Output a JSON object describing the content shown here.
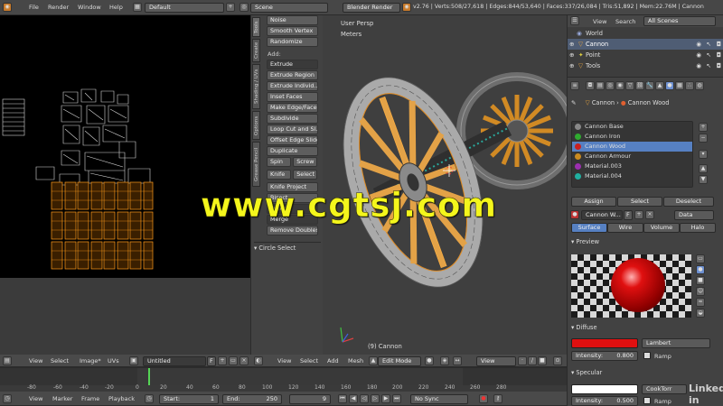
{
  "topbar": {
    "menus": [
      "File",
      "Render",
      "Window",
      "Help"
    ],
    "layout": "Default",
    "scene": "Scene",
    "engine": "Blender Render",
    "stats": "v2.76 | Verts:508/27,618 | Edges:844/53,640 | Faces:337/26,084 | Tris:51,892 | Mem:22.76M | Cannon"
  },
  "toolshelf": {
    "vtabs": [
      "Tools",
      "Create",
      "Shading / UVs",
      "Options",
      "Grease Pencil"
    ],
    "top_buttons": [
      "Noise",
      "Smooth Vertex",
      "Randomize"
    ],
    "add_label": "Add:",
    "extrude": "Extrude",
    "buttons": [
      "Extrude Region",
      "Extrude Individ...",
      "Inset Faces",
      "Make Edge/Face",
      "Subdivide",
      "Loop Cut and Sl...",
      "Offset Edge Slide",
      "Duplicate"
    ],
    "spin": "Spin",
    "screw": "Screw",
    "knife": "Knife",
    "select": "Select",
    "knife_project": "Knife Project",
    "bisect": "Bisect",
    "delete": "Delete",
    "merge": "Merge",
    "remove_doubles": "Remove Doubles",
    "operator_panel": "Circle Select"
  },
  "viewport": {
    "view_name": "User Persp",
    "units": "Meters",
    "object_label": "(9) Cannon"
  },
  "watermark": "www.cgtsj.com",
  "uv_header": {
    "items": [
      "View",
      "Select",
      "Image*",
      "UVs"
    ],
    "image_name": "Untitled",
    "f_label": "F"
  },
  "view3d_header": {
    "items": [
      "View",
      "Select",
      "Add",
      "Mesh"
    ],
    "mode": "Edit Mode",
    "pivot": "View"
  },
  "timeline": {
    "ticks": [
      "-80",
      "-60",
      "-40",
      "-20",
      "0",
      "20",
      "40",
      "60",
      "80",
      "100",
      "120",
      "140",
      "160",
      "180",
      "200",
      "220",
      "240",
      "260",
      "280"
    ],
    "menu": [
      "View",
      "Marker",
      "Frame",
      "Playback"
    ],
    "start_label": "Start:",
    "start": "1",
    "end_label": "End:",
    "end": "250",
    "current": "9",
    "sync": "No Sync"
  },
  "outliner": {
    "view": "View",
    "search": "Search",
    "filter": "All Scenes",
    "items": [
      "World",
      "Cannon",
      "Point",
      "Tools"
    ]
  },
  "properties": {
    "breadcrumb_obj": "Cannon",
    "breadcrumb_mat": "Cannon Wood",
    "materials": [
      {
        "name": "Cannon Base",
        "color": "#888888"
      },
      {
        "name": "Cannon Iron",
        "color": "#2faa2f"
      },
      {
        "name": "Cannon Wood",
        "color": "#c92020"
      },
      {
        "name": "Cannon Armour",
        "color": "#c98a20"
      },
      {
        "name": "Material.003",
        "color": "#9b2fb0"
      },
      {
        "name": "Material.004",
        "color": "#20b0a0"
      }
    ],
    "assign": "Assign",
    "select": "Select",
    "deselect": "Deselect",
    "mat_field": "Cannon W...",
    "mat_f": "F",
    "data": "Data",
    "tabs": [
      "Surface",
      "Wire",
      "Volume",
      "Halo"
    ],
    "preview": "Preview",
    "diffuse": "Diffuse",
    "diffuse_color": "#e01010",
    "shader": "Lambert",
    "intensity_label": "Intensity:",
    "intensity": "0.800",
    "ramp": "Ramp",
    "specular": "Specular",
    "spec_shader": "CookTorr",
    "spec_intensity": "0.500",
    "spec_ramp": "Ramp"
  },
  "brand": "Linked in"
}
